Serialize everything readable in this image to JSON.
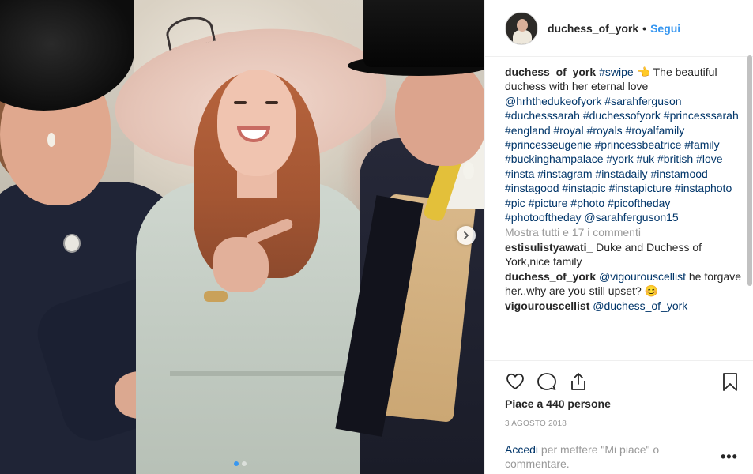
{
  "photo": {
    "next_icon": "chevron-right-icon",
    "dots": [
      true,
      false
    ]
  },
  "header": {
    "username": "duchess_of_york",
    "separator": "•",
    "follow_label": "Segui"
  },
  "caption": {
    "username": "duchess_of_york",
    "parts": [
      {
        "type": "link",
        "text": "#swipe"
      },
      {
        "type": "text",
        "text": " 👈"
      },
      {
        "type": "text",
        "text": " The beautiful duchess with her eternal love "
      },
      {
        "type": "link",
        "text": "@hrhthedukeofyork"
      },
      {
        "type": "text",
        "text": " "
      },
      {
        "type": "link",
        "text": "#sarahferguson"
      },
      {
        "type": "text",
        "text": " "
      },
      {
        "type": "link",
        "text": "#duchesssarah"
      },
      {
        "type": "text",
        "text": " "
      },
      {
        "type": "link",
        "text": "#duchessofyork"
      },
      {
        "type": "text",
        "text": " "
      },
      {
        "type": "link",
        "text": "#princesssarah"
      },
      {
        "type": "text",
        "text": " "
      },
      {
        "type": "link",
        "text": "#england"
      },
      {
        "type": "text",
        "text": " "
      },
      {
        "type": "link",
        "text": "#royal"
      },
      {
        "type": "text",
        "text": " "
      },
      {
        "type": "link",
        "text": "#royals"
      },
      {
        "type": "text",
        "text": " "
      },
      {
        "type": "link",
        "text": "#royalfamily"
      },
      {
        "type": "text",
        "text": " "
      },
      {
        "type": "link",
        "text": "#princesseugenie"
      },
      {
        "type": "text",
        "text": " "
      },
      {
        "type": "link",
        "text": "#princessbeatrice"
      },
      {
        "type": "text",
        "text": " "
      },
      {
        "type": "link",
        "text": "#family"
      },
      {
        "type": "text",
        "text": " "
      },
      {
        "type": "link",
        "text": "#buckinghampalace"
      },
      {
        "type": "text",
        "text": " "
      },
      {
        "type": "link",
        "text": "#york"
      },
      {
        "type": "text",
        "text": " "
      },
      {
        "type": "link",
        "text": "#uk"
      },
      {
        "type": "text",
        "text": " "
      },
      {
        "type": "link",
        "text": "#british"
      },
      {
        "type": "text",
        "text": " "
      },
      {
        "type": "link",
        "text": "#love"
      },
      {
        "type": "text",
        "text": " "
      },
      {
        "type": "link",
        "text": "#insta"
      },
      {
        "type": "text",
        "text": " "
      },
      {
        "type": "link",
        "text": "#instagram"
      },
      {
        "type": "text",
        "text": " "
      },
      {
        "type": "link",
        "text": "#instadaily"
      },
      {
        "type": "text",
        "text": " "
      },
      {
        "type": "link",
        "text": "#instamood"
      },
      {
        "type": "text",
        "text": " "
      },
      {
        "type": "link",
        "text": "#instagood"
      },
      {
        "type": "text",
        "text": " "
      },
      {
        "type": "link",
        "text": "#instapic"
      },
      {
        "type": "text",
        "text": " "
      },
      {
        "type": "link",
        "text": "#instapicture"
      },
      {
        "type": "text",
        "text": " "
      },
      {
        "type": "link",
        "text": "#instaphoto"
      },
      {
        "type": "text",
        "text": " "
      },
      {
        "type": "link",
        "text": "#pic"
      },
      {
        "type": "text",
        "text": " "
      },
      {
        "type": "link",
        "text": "#picture"
      },
      {
        "type": "text",
        "text": " "
      },
      {
        "type": "link",
        "text": "#photo"
      },
      {
        "type": "text",
        "text": " "
      },
      {
        "type": "link",
        "text": "#picoftheday"
      },
      {
        "type": "text",
        "text": " "
      },
      {
        "type": "link",
        "text": "#photooftheday"
      },
      {
        "type": "text",
        "text": " "
      },
      {
        "type": "link",
        "text": "@sarahferguson15"
      }
    ]
  },
  "view_all_comments": "Mostra tutti e 17 i commenti",
  "comments": [
    {
      "username": "estisulistyawati_",
      "parts": [
        {
          "type": "text",
          "text": "Duke and Duchess of York,nice family"
        }
      ]
    },
    {
      "username": "duchess_of_york",
      "parts": [
        {
          "type": "link",
          "text": "@vigourouscellist"
        },
        {
          "type": "text",
          "text": " he forgave her..why are you still upset? 😊"
        }
      ]
    },
    {
      "username": "vigourouscellist",
      "parts": [
        {
          "type": "link",
          "text": "@duchess_of_york"
        }
      ]
    }
  ],
  "actions": {
    "like_icon": "heart-icon",
    "comment_icon": "comment-bubble-icon",
    "share_icon": "share-icon",
    "save_icon": "bookmark-icon"
  },
  "likes_text": "Piace a 440 persone",
  "date_text": "3 agosto 2018",
  "add_comment": {
    "login_label": "Accedi",
    "rest": " per mettere \"Mi piace\" o commentare.",
    "more_label": "•••"
  },
  "colors": {
    "link": "#003569",
    "follow": "#3897f0",
    "muted": "#999999",
    "text": "#262626"
  }
}
